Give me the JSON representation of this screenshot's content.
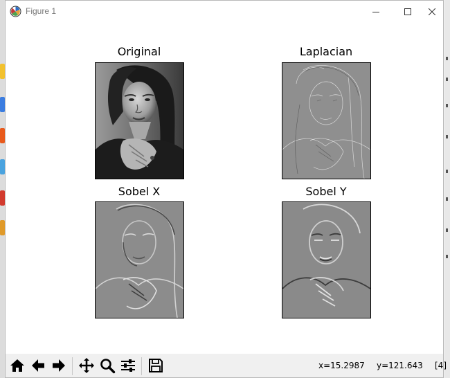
{
  "window": {
    "title": "Figure 1",
    "icons": {
      "app": "matplotlib-icon",
      "minimize": "minimize-icon",
      "maximize": "maximize-icon",
      "close": "close-icon"
    }
  },
  "figure": {
    "subplots": [
      {
        "title": "Original",
        "image": "grayscale portrait photo"
      },
      {
        "title": "Laplacian",
        "image": "Laplacian edge map"
      },
      {
        "title": "Sobel X",
        "image": "Sobel X gradient"
      },
      {
        "title": "Sobel Y",
        "image": "Sobel Y gradient"
      }
    ]
  },
  "toolbar": {
    "buttons": [
      {
        "name": "home-icon"
      },
      {
        "name": "back-icon"
      },
      {
        "name": "forward-icon"
      },
      {
        "name": "pan-icon"
      },
      {
        "name": "zoom-icon"
      },
      {
        "name": "configure-subplots-icon"
      },
      {
        "name": "save-icon"
      }
    ],
    "x_readout": "x=15.2987",
    "y_readout": "y=121.643",
    "pixel_value": "[4]"
  },
  "colors": {
    "canvas": "#ffffff",
    "toolbar": "#f0f0f0",
    "filtered_gray": "#8f8f8f"
  }
}
